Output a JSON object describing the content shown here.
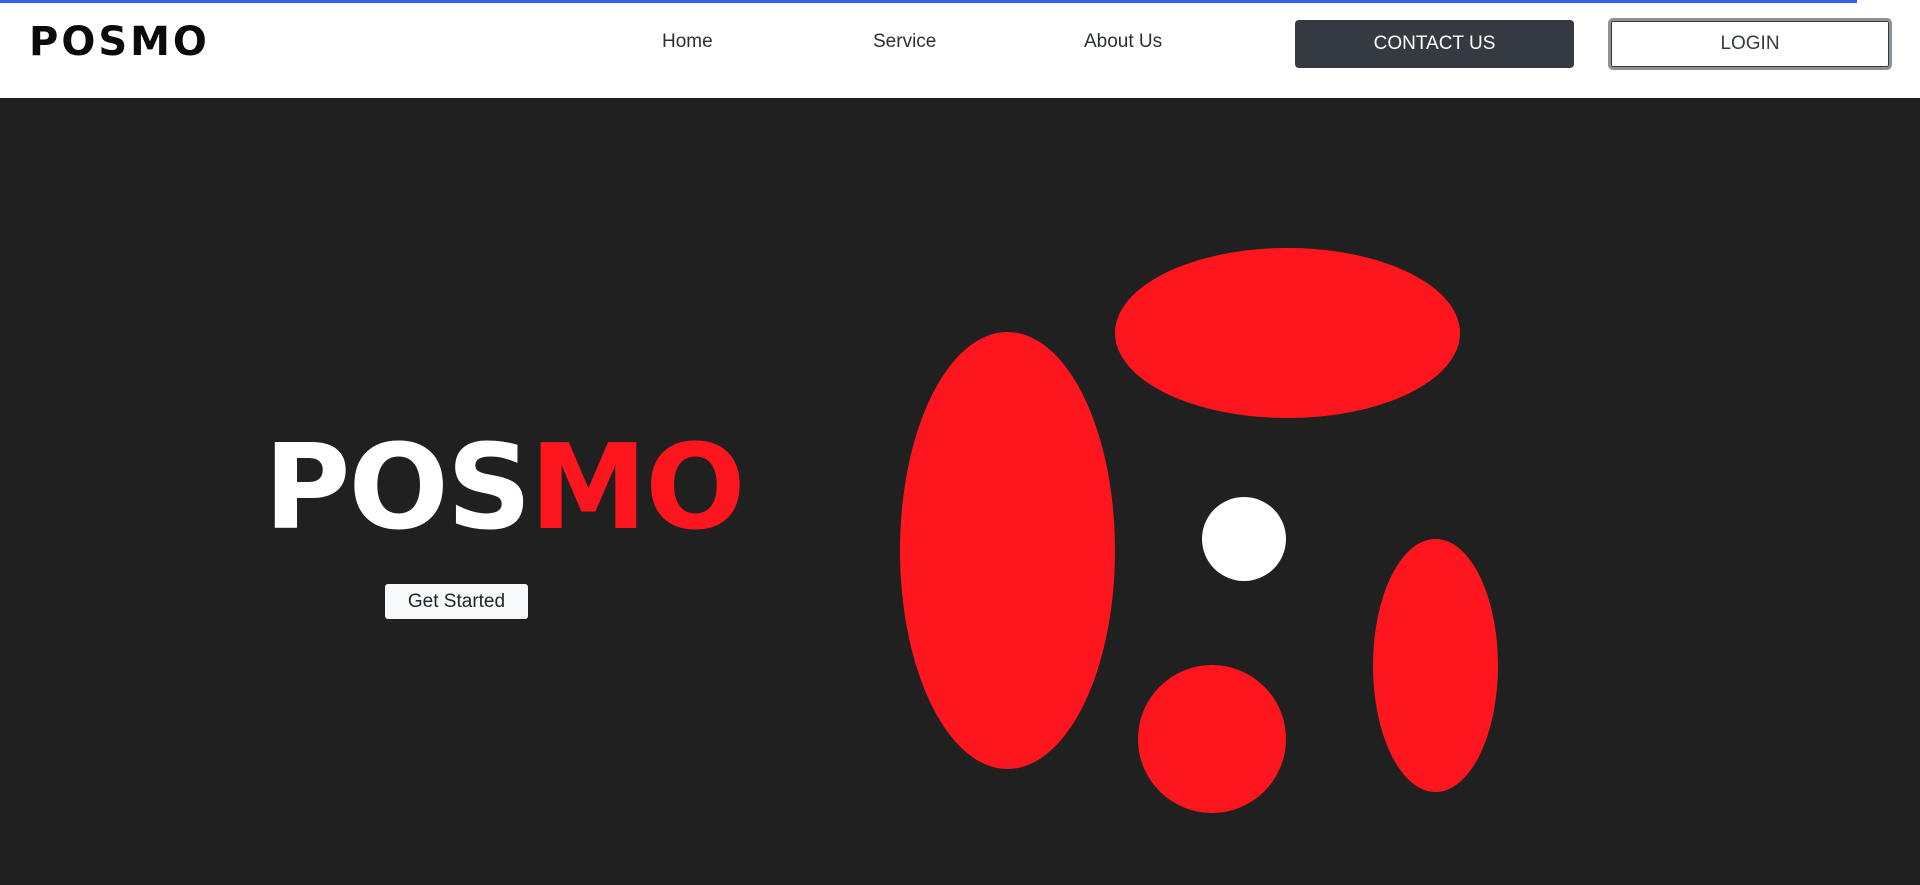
{
  "navbar": {
    "brand": "POSMO",
    "links": [
      {
        "label": "Home"
      },
      {
        "label": "Service"
      },
      {
        "label": "About Us"
      }
    ],
    "contact_label": "CONTACT US",
    "login_label": "LOGIN"
  },
  "hero": {
    "title_white": "POS",
    "title_red": "MO",
    "cta_label": "Get Started"
  },
  "colors": {
    "accent_red": "#fe161e",
    "hero_background": "#202020",
    "navbar_background": "#ffffff",
    "contact_button": "#343a40",
    "top_progress_line": "#2f63e8"
  }
}
